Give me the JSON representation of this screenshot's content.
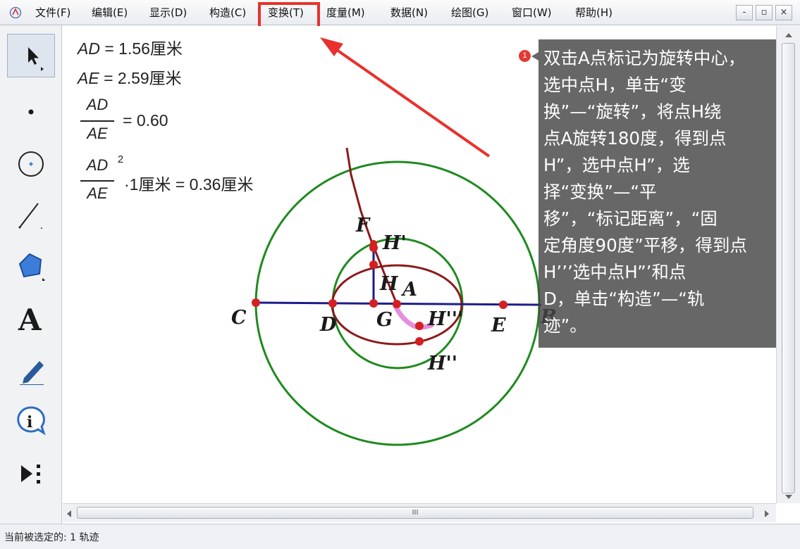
{
  "menu": {
    "items": [
      "文件(F)",
      "编辑(E)",
      "显示(D)",
      "构造(C)",
      "变换(T)",
      "度量(M)",
      "数据(N)",
      "绘图(G)",
      "窗口(W)",
      "帮助(H)"
    ],
    "highlighted_index": 4,
    "window_buttons": [
      "-",
      "▫",
      "×"
    ]
  },
  "toolbar": {
    "tools": [
      {
        "name": "arrow-tool-icon",
        "selected": true
      },
      {
        "name": "point-tool-icon"
      },
      {
        "name": "compass-tool-icon"
      },
      {
        "name": "straightedge-tool-icon"
      },
      {
        "name": "polygon-tool-icon"
      },
      {
        "name": "text-tool-icon"
      },
      {
        "name": "marker-tool-icon"
      },
      {
        "name": "information-tool-icon"
      },
      {
        "name": "custom-tool-icon"
      }
    ]
  },
  "measurements": {
    "ad_label": "AD",
    "ad_value": " = 1.56厘米",
    "ae_label": "AE",
    "ae_value": " = 2.59厘米",
    "ratio_num": "AD",
    "ratio_den": "AE",
    "ratio_value": "= 0.60",
    "sq_num": "AD",
    "sq_exp": "2",
    "sq_den": "AE",
    "sq_value": "·1厘米 = 0.36厘米"
  },
  "geometry": {
    "points": {
      "C": "C",
      "D": "D",
      "G": "G",
      "A": "A",
      "E": "E",
      "B": "B",
      "F": "F",
      "H": "H",
      "H1": "H'",
      "H2": "H''",
      "H3": "H'''"
    },
    "colors": {
      "outer_circle": "#1e8a1e",
      "inner_circle": "#1e8a1e",
      "ellipse": "#8b1a1a",
      "line": "#1c1c8c",
      "ray": "#8b1a1a",
      "point": "#d42020",
      "locus_highlight": "#e07ad8"
    }
  },
  "callout": {
    "step": "1",
    "text": "双击A点标记为旋转中心，选中点H，单击“变换”—“旋转”，将点H绕点A旋转180度，得到点H”，选中点H”，选择“变换”—“平移”，“标记距离”，“固定角度90度”平移，得到点H’’’选中点H”’和点D，单击“构造”—“轨迹”。",
    "lines": [
      "双击A点标记为旋转中心，",
      "选中点H，单击“变",
      "换”—“旋转”，将点H绕",
      "点A旋转180度，得到点",
      "H”，选中点H”，选",
      "择“变换”—“平",
      "移”，“标记距离”，“固",
      "定角度90度”平移，得到点",
      "H’’’选中点H”’和点",
      "D，单击“构造”—“轨",
      "迹”。"
    ]
  },
  "annotation": {
    "arrow_color": "#e8312c"
  },
  "scroll": {
    "h_thumb_grip": "III"
  },
  "status": {
    "text": "当前被选定的: 1 轨迹"
  }
}
